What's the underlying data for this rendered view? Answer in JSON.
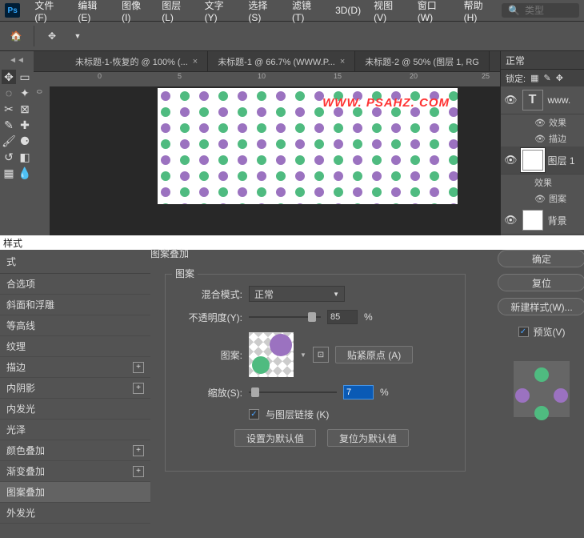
{
  "menu": {
    "file": "文件(F)",
    "edit": "编辑(E)",
    "image": "图像(I)",
    "layer": "图层(L)",
    "type": "文字(Y)",
    "select": "选择(S)",
    "filter": "滤镜(T)",
    "threed": "3D(D)",
    "view": "视图(V)",
    "window": "窗口(W)",
    "help": "帮助(H)"
  },
  "search": {
    "placeholder": "类型"
  },
  "tabs": {
    "t1": "未标题-1-恢复的 @ 100% (...",
    "t2": "未标题-1 @ 66.7% (WWW.P...",
    "t3": "未标题-2 @ 50% (图层 1, RG"
  },
  "ruler": {
    "h0": "0",
    "h1": "5",
    "h2": "10",
    "h3": "15",
    "h4": "20",
    "h5": "25",
    "v0": "0"
  },
  "watermark": "WWW. PSAHZ. COM",
  "layers": {
    "blend": "正常",
    "lock": "锁定:",
    "text_layer": "www.",
    "fx": "效果",
    "stroke_fx": "描边",
    "layer1": "图层 1",
    "pattern_fx": "图案",
    "bg": "背景"
  },
  "dialog": {
    "title_prefix": "样式",
    "section": "图案叠加",
    "group": "图案",
    "blend_mode_label": "混合模式:",
    "blend_mode_value": "正常",
    "opacity_label": "不透明度(Y):",
    "opacity_value": "85",
    "percent": "%",
    "pattern_label": "图案:",
    "snap_origin": "贴紧原点 (A)",
    "scale_label": "缩放(S):",
    "scale_value": "7",
    "link_layer": "与图层链接 (K)",
    "set_default": "设置为默认值",
    "reset_default": "复位为默认值",
    "ok": "确定",
    "cancel": "复位",
    "new_style": "新建样式(W)...",
    "preview": "预览(V)"
  },
  "styles": {
    "head": "式",
    "blend_opts": "合选项",
    "bevel": "斜面和浮雕",
    "contour": "等高线",
    "texture": "纹理",
    "stroke": "描边",
    "inner_shadow": "内阴影",
    "inner_glow": "内发光",
    "satin": "光泽",
    "color_overlay": "颜色叠加",
    "gradient_overlay": "渐变叠加",
    "pattern_overlay": "图案叠加",
    "outer_glow": "外发光"
  }
}
